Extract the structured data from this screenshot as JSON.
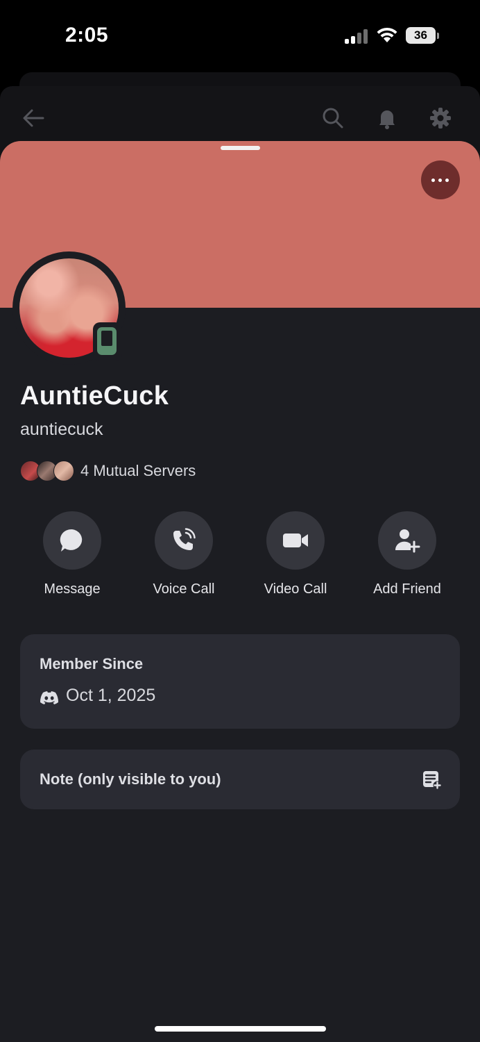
{
  "status_bar": {
    "time": "2:05",
    "battery": "36"
  },
  "profile": {
    "display_name": "AuntieCuck",
    "username": "auntiecuck",
    "mutual_servers": "4 Mutual Servers",
    "banner_color": "#cb6e64"
  },
  "actions": [
    {
      "label": "Message",
      "icon": "chat-bubble-icon"
    },
    {
      "label": "Voice Call",
      "icon": "phone-call-icon"
    },
    {
      "label": "Video Call",
      "icon": "video-camera-icon"
    },
    {
      "label": "Add Friend",
      "icon": "add-friend-icon"
    }
  ],
  "member_since": {
    "title": "Member Since",
    "date": "Oct 1, 2025"
  },
  "note": {
    "label": "Note (only visible to you)"
  }
}
